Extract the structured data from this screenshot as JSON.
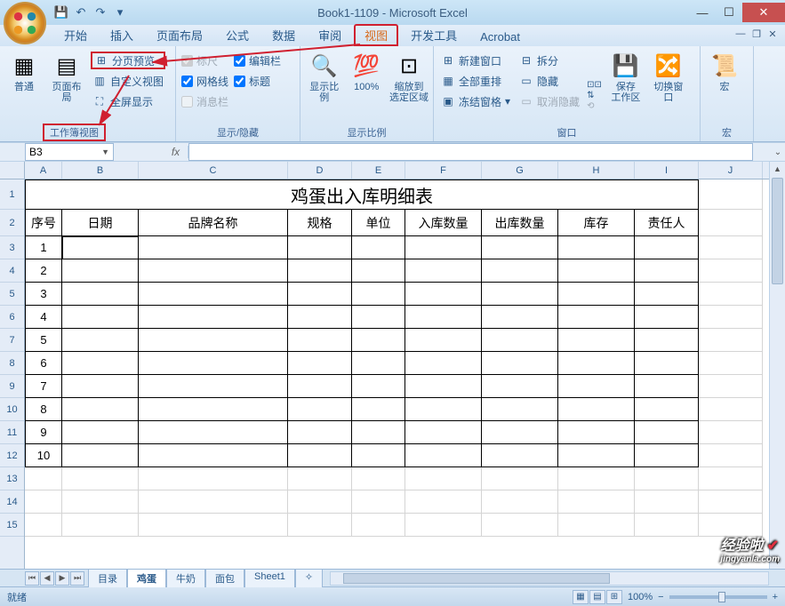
{
  "window": {
    "title": "Book1-1109 - Microsoft Excel"
  },
  "qat": {
    "save": "💾",
    "undo": "↶",
    "redo": "↷",
    "custom": "▾"
  },
  "tabs": {
    "items": [
      "开始",
      "插入",
      "页面布局",
      "公式",
      "数据",
      "审阅",
      "视图",
      "开发工具",
      "Acrobat"
    ],
    "active": "视图"
  },
  "ribbon": {
    "group1": {
      "label": "工作簿视图",
      "normal": "普通",
      "pagelayout": "页面布局",
      "pagebreak": "分页预览",
      "custom": "自定义视图",
      "fullscreen": "全屏显示"
    },
    "group2": {
      "label": "显示/隐藏",
      "ruler": "标尺",
      "gridlines": "网格线",
      "messagebar": "消息栏",
      "formulabar": "编辑栏",
      "headings": "标题"
    },
    "group3": {
      "label": "显示比例",
      "zoom": "显示比例",
      "hundred": "100%",
      "zoomsel": "缩放到\n选定区域"
    },
    "group4": {
      "label": "窗口",
      "newwin": "新建窗口",
      "arrange": "全部重排",
      "freeze": "冻结窗格",
      "split": "拆分",
      "hide": "隐藏",
      "unhide": "取消隐藏",
      "save_ws": "保存\n工作区",
      "switch": "切换窗口"
    },
    "group5": {
      "label": "宏",
      "macro": "宏"
    }
  },
  "namebox": {
    "value": "B3"
  },
  "columns": [
    "A",
    "B",
    "C",
    "D",
    "E",
    "F",
    "G",
    "H",
    "I",
    "J"
  ],
  "rows": [
    "1",
    "2",
    "3",
    "4",
    "5",
    "6",
    "7",
    "8",
    "9",
    "10",
    "11",
    "12",
    "13",
    "14",
    "15"
  ],
  "table": {
    "title": "鸡蛋出入库明细表",
    "headers": [
      "序号",
      "日期",
      "品牌名称",
      "规格",
      "单位",
      "入库数量",
      "出库数量",
      "库存",
      "责任人"
    ],
    "seq": [
      "1",
      "2",
      "3",
      "4",
      "5",
      "6",
      "7",
      "8",
      "9",
      "10"
    ]
  },
  "sheettabs": [
    "目录",
    "鸡蛋",
    "牛奶",
    "面包",
    "Sheet1"
  ],
  "active_sheet": "鸡蛋",
  "statusbar": {
    "ready": "就绪",
    "zoom": "100%"
  },
  "watermark": {
    "main": "经验啦",
    "sub": "jingyanla.com"
  }
}
